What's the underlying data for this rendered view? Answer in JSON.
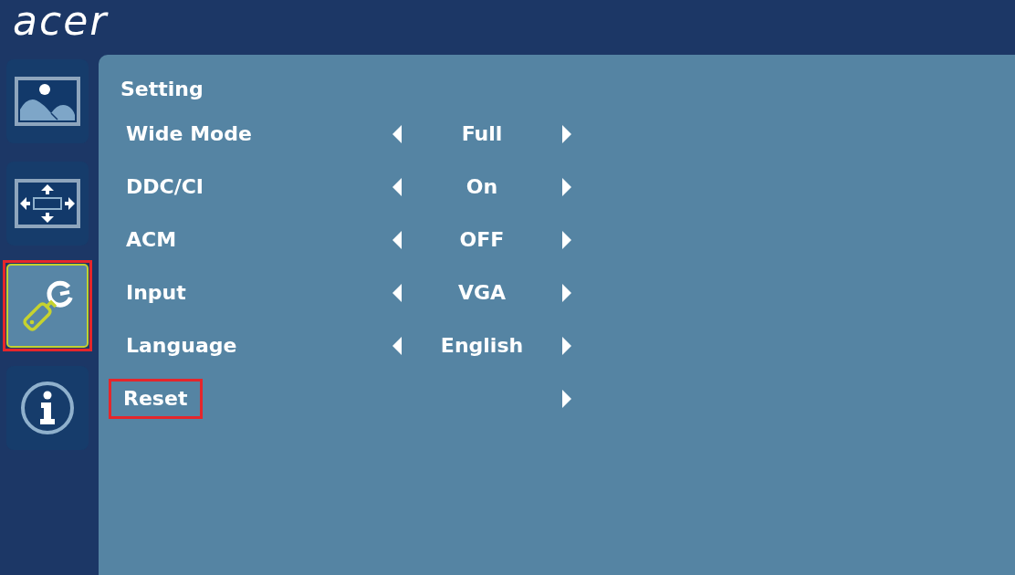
{
  "header": {
    "logo": "acer"
  },
  "sidebar": {
    "tabs": [
      {
        "kind": "picture",
        "selected": false,
        "callout": false
      },
      {
        "kind": "display",
        "selected": false,
        "callout": false
      },
      {
        "kind": "setting",
        "selected": true,
        "callout": true
      },
      {
        "kind": "information",
        "selected": false,
        "callout": false
      }
    ]
  },
  "panel": {
    "title": "Setting",
    "rows": [
      {
        "kind": "choice",
        "label": "Wide Mode",
        "value": "Full",
        "callout": false
      },
      {
        "kind": "choice",
        "label": "DDC/CI",
        "value": "On",
        "callout": false
      },
      {
        "kind": "choice",
        "label": "ACM",
        "value": "OFF",
        "callout": false
      },
      {
        "kind": "choice",
        "label": "Input",
        "value": "VGA",
        "callout": false
      },
      {
        "kind": "choice",
        "label": "Language",
        "value": "English",
        "callout": false
      },
      {
        "kind": "action",
        "label": "Reset",
        "callout": true
      }
    ]
  }
}
